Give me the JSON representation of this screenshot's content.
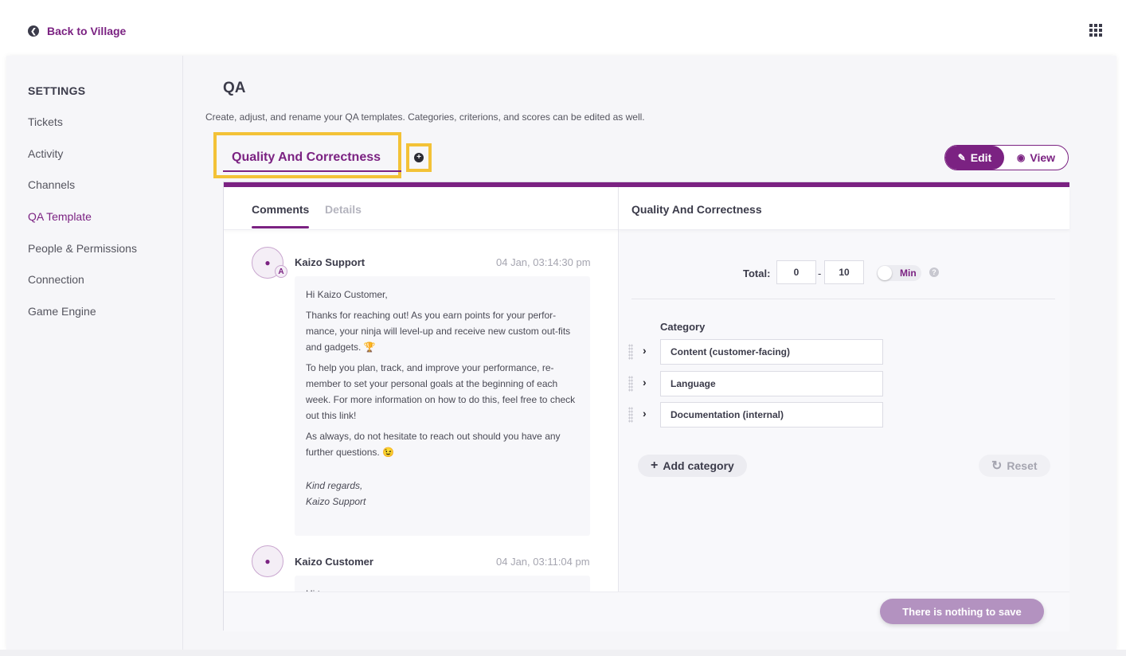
{
  "topbar": {
    "back_label": "Back to Village"
  },
  "sidebar": {
    "heading": "SETTINGS",
    "items": [
      {
        "label": "Tickets"
      },
      {
        "label": "Activity"
      },
      {
        "label": "Channels"
      },
      {
        "label": "QA Template",
        "active": true
      },
      {
        "label": "People & Permissions"
      },
      {
        "label": "Connection"
      },
      {
        "label": "Game Engine"
      }
    ]
  },
  "main": {
    "title": "QA",
    "description": "Create, adjust, and rename your QA templates. Categories, criterions, and scores can be edited as well.",
    "template_tab": "Quality And Correctness",
    "mode": {
      "edit_label": "Edit",
      "view_label": "View",
      "active": "Edit"
    }
  },
  "left_panel": {
    "tabs": {
      "comments": "Comments",
      "details": "Details",
      "active": "Comments"
    },
    "messages": [
      {
        "author": "Kaizo Support",
        "time": "04 Jan, 03:14:30 pm",
        "badge": "A",
        "greeting": "Hi Kaizo Customer,",
        "p1": "Thanks for reaching out! As you earn points for your perfor-mance, your ninja will level-up and receive new custom out-fits and gadgets. 🏆",
        "p2": "To help you plan, track, and improve your performance, re-member to set your personal goals at the beginning of each week. For more information on how to do this, feel free to check out this link!",
        "p3": "As always, do not hesitate to reach out should you have any further questions. 😉",
        "sig1": "Kind regards,",
        "sig2": "Kaizo Support"
      },
      {
        "author": "Kaizo Customer",
        "time": "04 Jan, 03:11:04 pm",
        "greeting": "Hi team,"
      }
    ]
  },
  "right_panel": {
    "title": "Quality And Correctness",
    "total_label": "Total:",
    "total_min": "0",
    "total_max": "10",
    "toggle_label": "Min",
    "category_label": "Category",
    "categories": [
      {
        "name": "Content (customer-facing)"
      },
      {
        "name": "Language"
      },
      {
        "name": "Documentation (internal)"
      }
    ],
    "add_category_label": "Add category",
    "reset_label": "Reset"
  },
  "footer": {
    "save_label": "There is nothing to save"
  },
  "colors": {
    "accent": "#7b2282",
    "highlight": "#f3c237",
    "save_disabled": "#b392c0"
  }
}
